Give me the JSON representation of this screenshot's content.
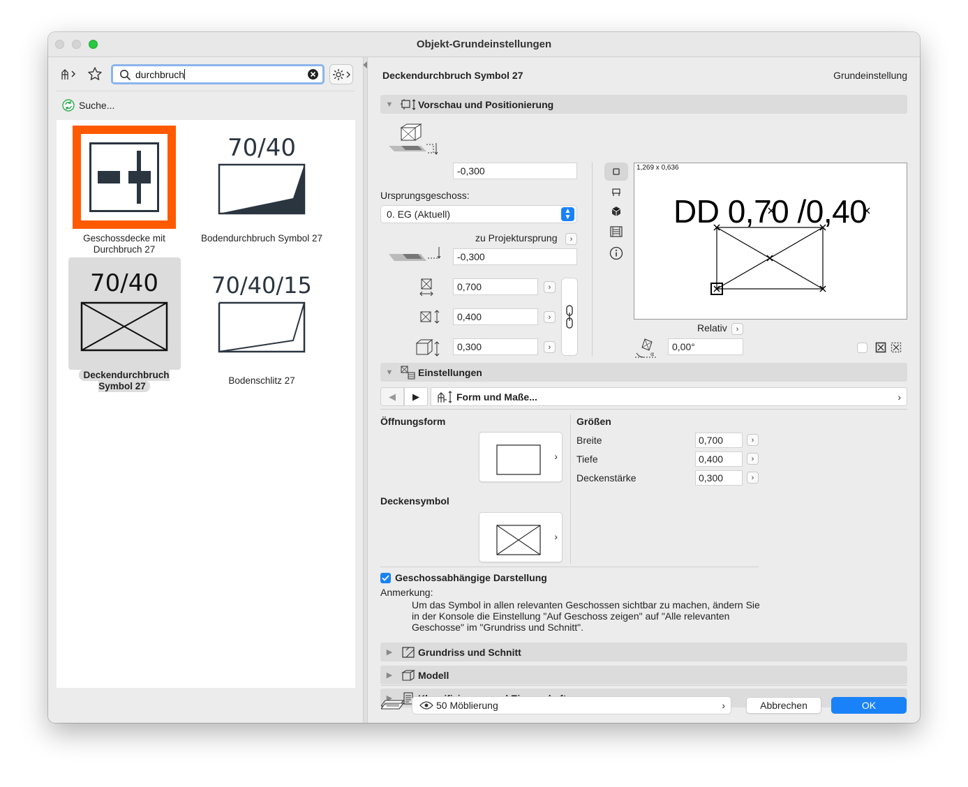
{
  "window": {
    "title": "Objekt-Grundeinstellungen"
  },
  "search": {
    "value": "durchbruch"
  },
  "left": {
    "searching_label": "Suche...",
    "tiles": [
      {
        "label": "Geschossdecke mit Durchbruch 27",
        "accent": "#ff5a00"
      },
      {
        "label": "Bodendurchbruch Symbol 27",
        "caption": "70/40"
      },
      {
        "label": "Deckendurchbruch Symbol 27",
        "caption": "70/40"
      },
      {
        "label": "Bodenschlitz 27",
        "caption": "70/40/15"
      }
    ]
  },
  "header": {
    "object_name": "Deckendurchbruch Symbol 27",
    "default_label": "Grundeinstellung"
  },
  "sections": {
    "preview": "Vorschau und Positionierung",
    "settings": "Einstellungen",
    "floorplan": "Grundriss und Schnitt",
    "model": "Modell",
    "classification": "Klassifizierung und Eigenschaften"
  },
  "positioning": {
    "top_offset": "-0,300",
    "home_story_label": "Ursprungsgeschoss:",
    "home_story_value": "0. EG (Aktuell)",
    "project_origin_label": "zu Projektursprung",
    "origin_offset": "-0,300",
    "width": "0,700",
    "depth": "0,400",
    "height": "0,300",
    "relative_label": "Relativ",
    "angle": "0,00°",
    "preview_dims": "1,269 x 0,636",
    "preview_text": "DD 0,70 /0,40"
  },
  "settings": {
    "page_label": "Form und Maße...",
    "opening_shape_label": "Öffnungsform",
    "slab_symbol_label": "Deckensymbol",
    "sizes_label": "Größen",
    "sizes": [
      {
        "label": "Breite",
        "value": "0,700"
      },
      {
        "label": "Tiefe",
        "value": "0,400"
      },
      {
        "label": "Deckenstärke",
        "value": "0,300"
      }
    ],
    "story_sensitive_label": "Geschossabhängige Darstellung",
    "story_sensitive_checked": true,
    "note_label": "Anmerkung:",
    "note_text": "Um das Symbol in allen relevanten Geschossen sichtbar zu machen, ändern Sie in der Konsole die Einstellung \"Auf Geschoss zeigen\" auf \"Alle relevanten Geschosse\" im \"Grundriss und Schnitt\"."
  },
  "footer": {
    "layer": "50 Möblierung",
    "cancel_label": "Abbrechen",
    "ok_label": "OK",
    "accent": "#1a82f8"
  }
}
